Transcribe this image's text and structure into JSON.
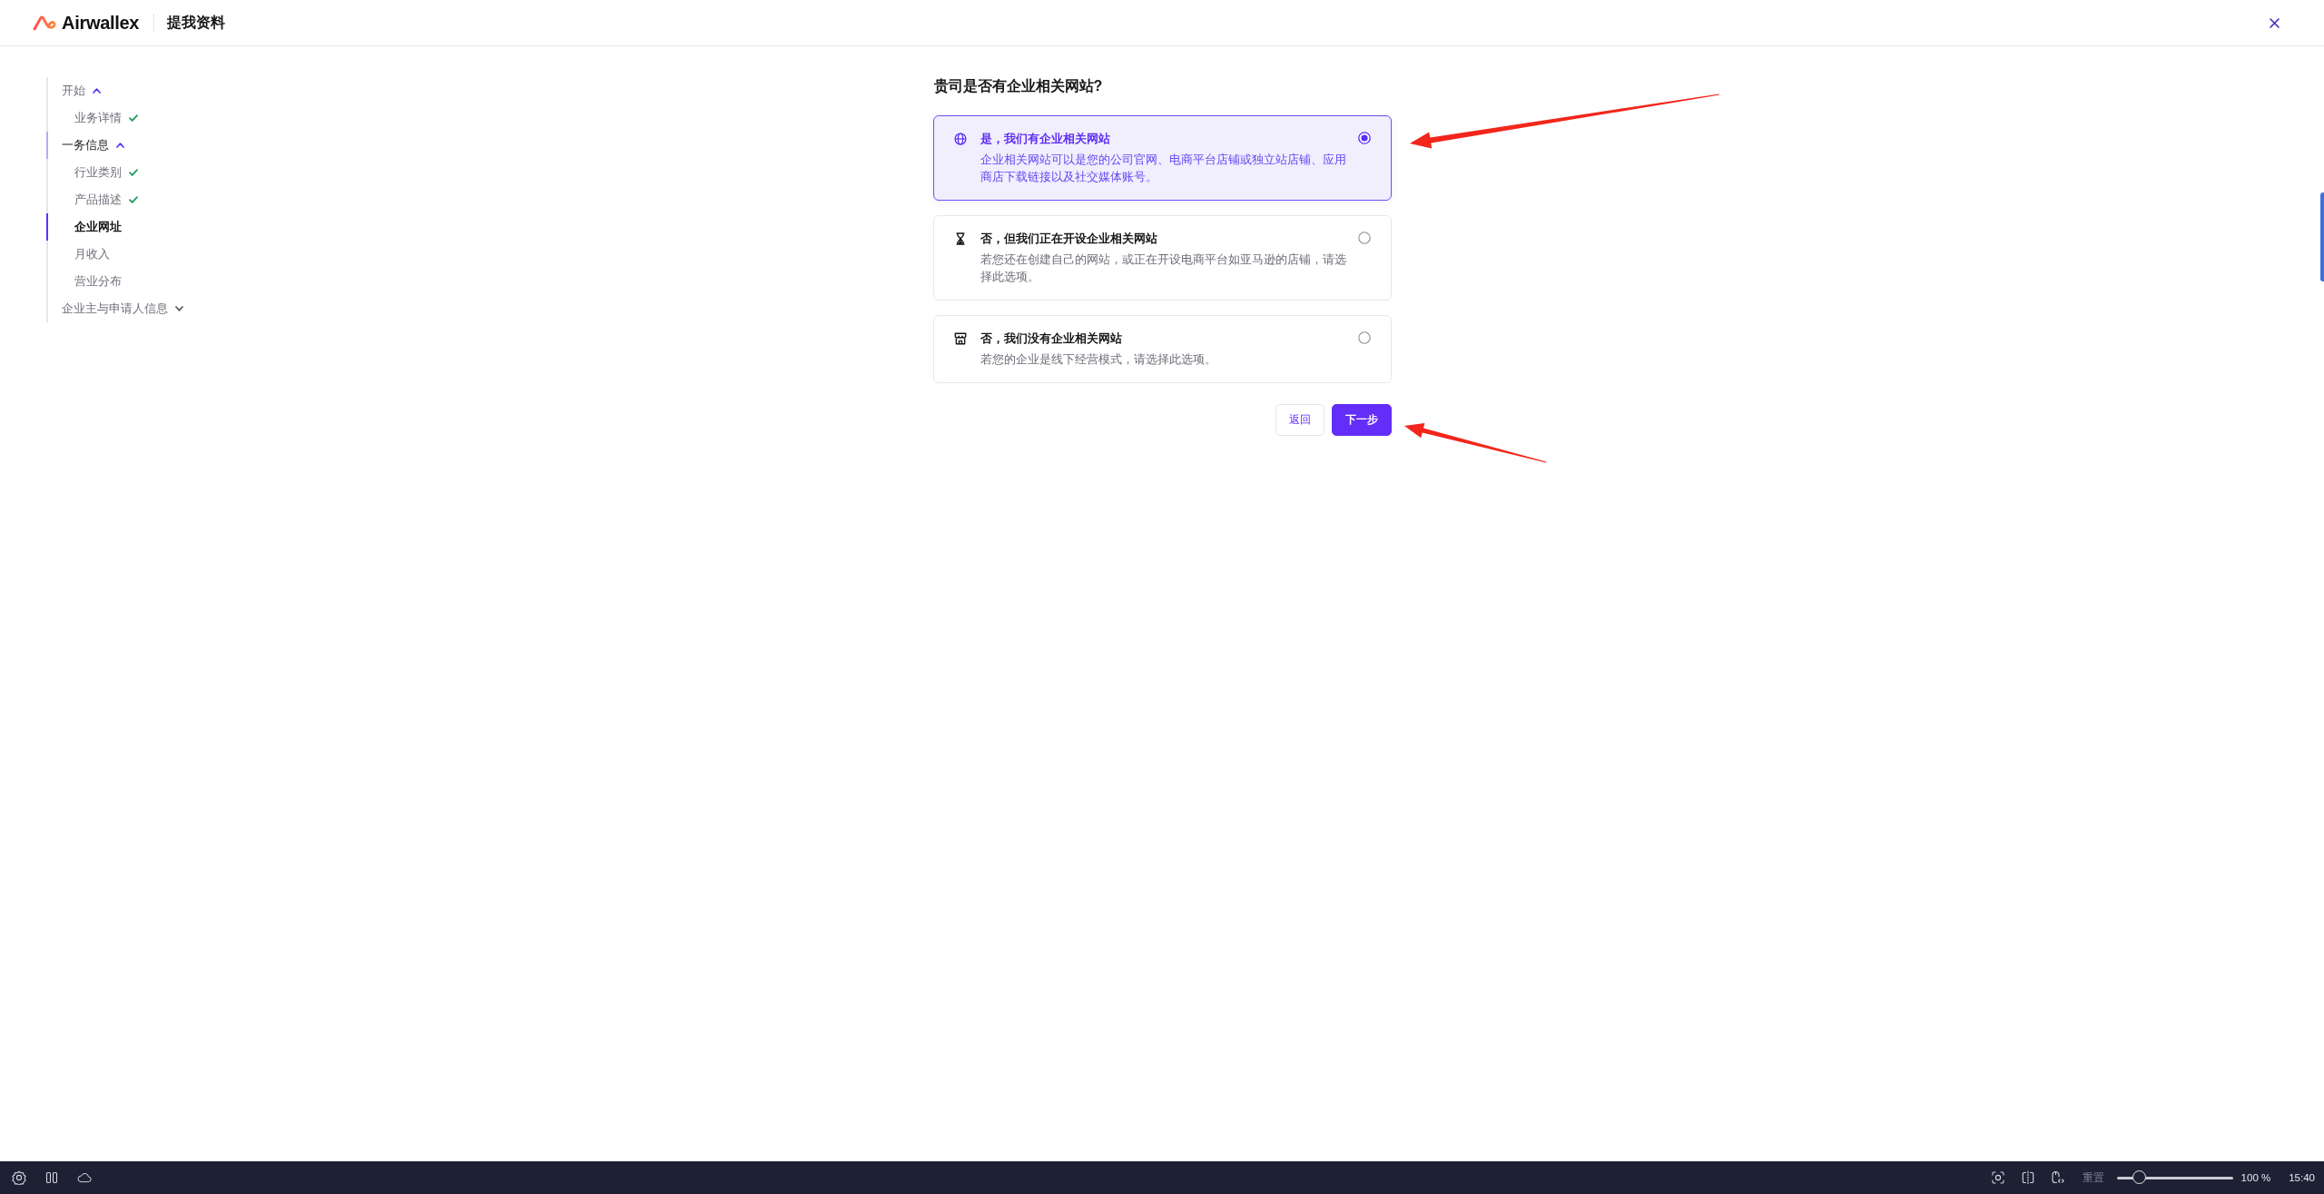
{
  "header": {
    "brand": "Airwallex",
    "title": "提我资料"
  },
  "sidebar": {
    "sections": [
      {
        "label": "开始",
        "expanded": true,
        "selected": false,
        "children": [
          {
            "label": "业务详情",
            "completed": true,
            "selected": false
          }
        ]
      },
      {
        "label": "一务信息",
        "expanded": true,
        "selected": false,
        "children": [
          {
            "label": "行业类别",
            "completed": true,
            "selected": false
          },
          {
            "label": "产品描述",
            "completed": true,
            "selected": false
          },
          {
            "label": "企业网址",
            "completed": false,
            "selected": true
          },
          {
            "label": "月收入",
            "completed": false,
            "selected": false
          },
          {
            "label": "营业分布",
            "completed": false,
            "selected": false
          }
        ]
      },
      {
        "label": "企业主与申请人信息",
        "expanded": false,
        "selected": false
      }
    ]
  },
  "question": {
    "title": "贵司是否有企业相关网站?",
    "options": [
      {
        "title": "是，我们有企业相关网站",
        "description": "企业相关网站可以是您的公司官网、电商平台店铺或独立站店铺、应用商店下载链接以及社交媒体账号。",
        "selected": true
      },
      {
        "title": "否，但我们正在开设企业相关网站",
        "description": "若您还在创建自己的网站，或正在开设电商平台如亚马逊的店铺，请选择此选项。",
        "selected": false
      },
      {
        "title": "否，我们没有企业相关网站",
        "description": "若您的企业是线下经营模式，请选择此选项。",
        "selected": false
      }
    ]
  },
  "actions": [
    {
      "label": "返回",
      "kind": "secondary"
    },
    {
      "label": "下一步",
      "kind": "primary"
    }
  ],
  "taskbar": {
    "reset_label": "重置",
    "zoom_slider": {
      "level": 0.2
    },
    "zoom_reading": "100 %",
    "clock": "15:40"
  }
}
